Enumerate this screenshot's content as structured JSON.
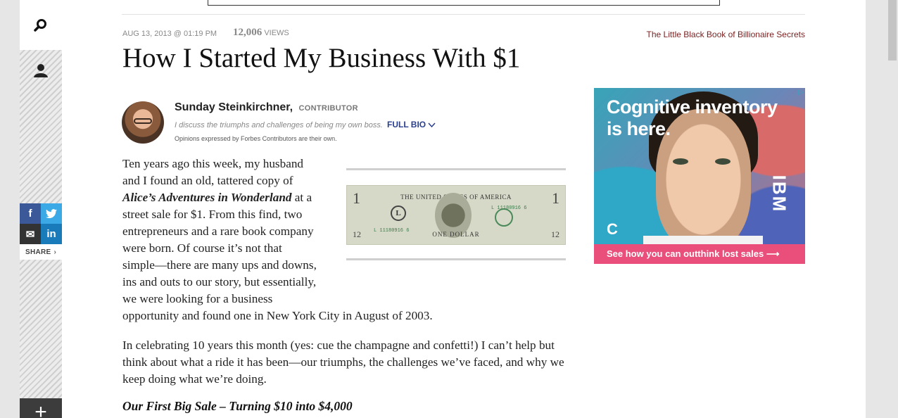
{
  "sidebar": {
    "share_label": "SHARE",
    "share_buttons": {
      "facebook": "f",
      "twitter": "t",
      "email": "✉",
      "linkedin": "in"
    },
    "plus": "+"
  },
  "article": {
    "date": "AUG 13, 2013 @ 01:19 PM",
    "views_count": "12,006",
    "views_label": "VIEWS",
    "top_link": "The Little Black Book of Billionaire Secrets",
    "title": "How I Started My Business With $1",
    "author": {
      "name": "Sunday Steinkirchner,",
      "role": "CONTRIBUTOR",
      "description": "I discuss the triumphs and challenges of being my own boss.",
      "full_bio": "FULL BIO",
      "note": "Opinions expressed by Forbes Contributors are their own."
    },
    "p1_a": "Ten years ago this week, my husband and I found an old, tattered copy of ",
    "p1_book": "Alice’s Adventures in Wonderland",
    "p1_b": " at a street sale for $1. From this find, two entrepreneurs and a rare book company were born. Of course it’s not that simple—there are many ups and downs, ins and outs to our story, but essentially, we were looking for a business opportunity and found one in New York City in August of 2003.",
    "p2": "In celebrating 10 years this month (yes: cue the champagne and confetti!) I can’t help but think about what a ride it has been—our triumphs, the challenges we’ve faced, and why we keep doing what we’re doing.",
    "h3": "Our First Big Sale – Turning $10 into $4,000"
  },
  "bill": {
    "header": "THE UNITED STATES OF AMERICA",
    "footer": "ONE DOLLAR",
    "denom_big": "1",
    "denom_small": "12",
    "serial": "L 11180916 6",
    "district_letter": "L"
  },
  "ad": {
    "headline_1": "Cognitive inventory",
    "headline_2": "is here.",
    "brand": "IBM",
    "cta": "See how you can outthink lost sales  ⟶",
    "adchoices": "▷"
  }
}
